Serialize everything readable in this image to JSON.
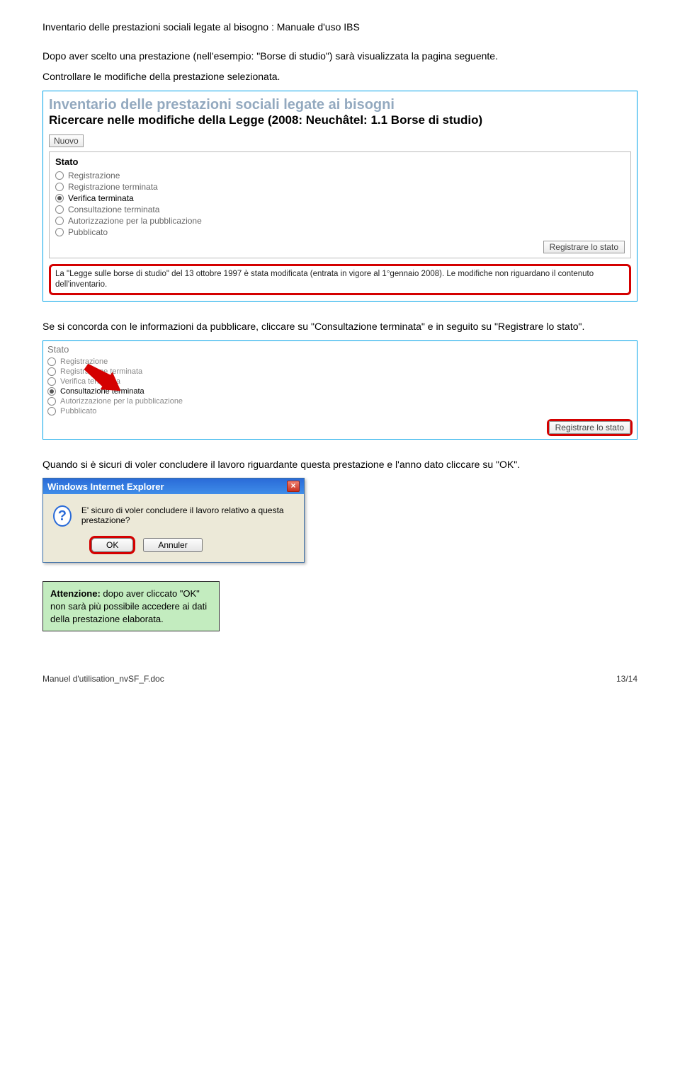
{
  "docHeader": "Inventario delle prestazioni sociali legate al bisogno : Manuale d'uso IBS",
  "para1": "Dopo aver scelto una prestazione (nell'esempio: \"Borse di studio\") sarà visualizzata la pagina seguente.",
  "para2": "Controllare le modifiche della prestazione selezionata.",
  "ss1": {
    "headline": "Inventario delle prestazioni sociali legate ai bisogni",
    "subhead": "Ricercare nelle modifiche della Legge (2008: Neuchâtel: 1.1 Borse di studio)",
    "nuovo": "Nuovo",
    "statoLabel": "Stato",
    "radios": [
      "Registrazione",
      "Registrazione terminata",
      "Verifica terminata",
      "Consultazione terminata",
      "Autorizzazione per la pubblicazione",
      "Pubblicato"
    ],
    "checkedIndex": 2,
    "registerBtn": "Registrare lo stato",
    "redText": "La \"Legge sulle borse di studio\" del 13 ottobre 1997 è stata modificata (entrata in vigore al 1°gennaio 2008). Le modifiche non riguardano il contenuto dell'inventario."
  },
  "para3": "Se si concorda con le informazioni da pubblicare, cliccare su \"Consultazione terminata\" e in seguito su \"Registrare lo stato\".",
  "ss2": {
    "statoLabel": "Stato",
    "radios": [
      "Registrazione",
      "Registrazione terminata",
      "Verifica terminata",
      "Consultazione terminata",
      "Autorizzazione per la pubblicazione",
      "Pubblicato"
    ],
    "checkedIndex": 3,
    "registerBtn": "Registrare lo stato"
  },
  "para4": "Quando si è sicuri di voler concludere il lavoro riguardante questa prestazione e l'anno dato cliccare su \"OK\".",
  "dialog": {
    "title": "Windows Internet Explorer",
    "msg": "E' sicuro di voler concludere il lavoro relativo a questa prestazione?",
    "ok": "OK",
    "cancel": "Annuler"
  },
  "note": {
    "bold": "Attenzione:",
    "rest": " dopo aver cliccato \"OK\" non sarà più possibile accedere ai dati della prestazione elaborata."
  },
  "footer": {
    "left": "Manuel d'utilisation_nvSF_F.doc",
    "right": "13/14"
  }
}
